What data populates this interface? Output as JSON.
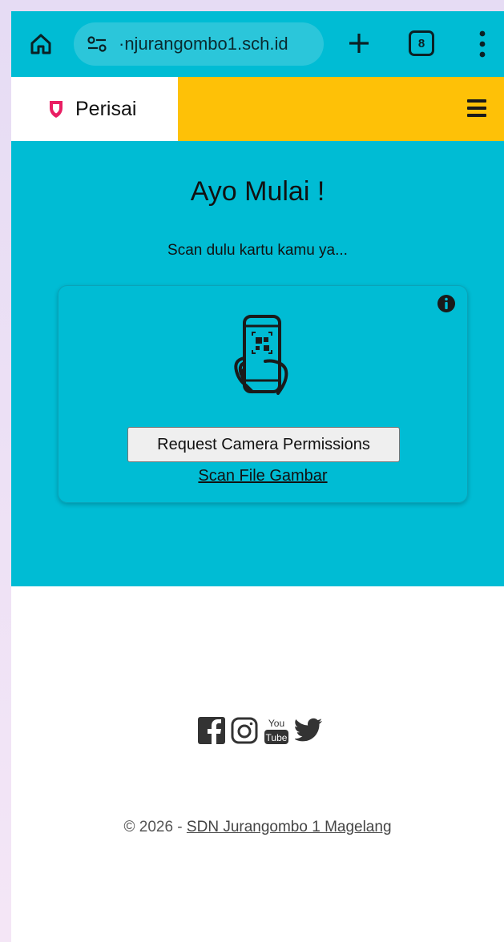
{
  "browser": {
    "url": "·njurangombo1.sch.id",
    "tab_count": "8"
  },
  "header": {
    "brand": "Perisai",
    "brand_color": "#e91e63",
    "accent_color": "#fec107"
  },
  "hero": {
    "title": "Ayo Mulai !",
    "subtitle": "Scan dulu kartu kamu ya...",
    "background_color": "#00bcd4"
  },
  "scanner": {
    "permission_button": "Request Camera Permissions",
    "scan_file_link": "Scan File Gambar",
    "icons": [
      "info-icon",
      "phone-qr-scan-icon"
    ]
  },
  "footer": {
    "social_icons": [
      "facebook-icon",
      "instagram-icon",
      "youtube-icon",
      "twitter-icon"
    ],
    "youtube_top": "You",
    "youtube_bottom": "Tube",
    "copyright_prefix": "© 2026 - ",
    "school_link": "SDN Jurangombo 1 Magelang"
  }
}
